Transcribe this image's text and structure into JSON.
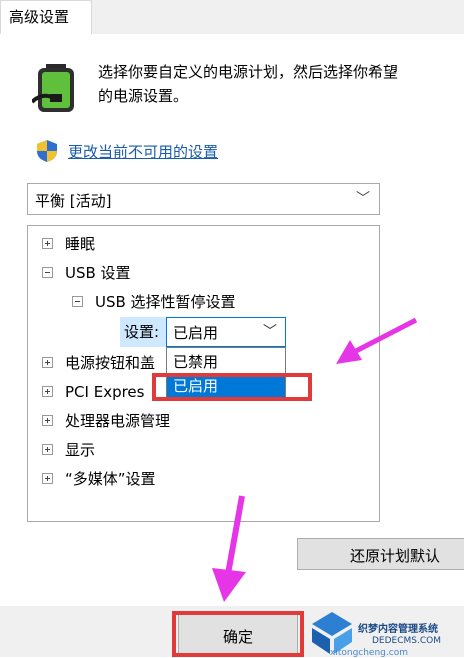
{
  "tab": {
    "label": "高级设置"
  },
  "description": {
    "line1": "选择你要自定义的电源计划，然后选择你希望",
    "line2": "的电源设置。"
  },
  "link": {
    "text": "更改当前不可用的设置"
  },
  "plan_select": {
    "value": "平衡 [活动]"
  },
  "tree": {
    "items": [
      {
        "label": "睡眠",
        "state": "collapsed"
      },
      {
        "label": "USB 设置",
        "state": "expanded"
      },
      {
        "label": "USB 选择性暂停设置",
        "state": "expanded"
      },
      {
        "label": "电源按钮和盖",
        "state": "collapsed"
      },
      {
        "label": "PCI Expres",
        "state": "collapsed"
      },
      {
        "label": "处理器电源管理",
        "state": "collapsed"
      },
      {
        "label": "显示",
        "state": "collapsed"
      },
      {
        "label": "“多媒体”设置",
        "state": "collapsed"
      }
    ],
    "setting_label": "设置:",
    "setting_value": "已启用",
    "dropdown_options": [
      "已禁用",
      "已启用"
    ],
    "selected_option": "已启用"
  },
  "buttons": {
    "restore": "还原计划默认",
    "ok": "确定"
  },
  "watermark": {
    "line1": "织梦内容管理系统",
    "line2": "DEDECMS.COM",
    "brand": "系统城",
    "url": "xitongcheng.com"
  },
  "colors": {
    "accent": "#0078d7",
    "link": "#1a5ca8",
    "highlight_box": "#e03a3a",
    "annotation_arrow": "#e635e6"
  }
}
